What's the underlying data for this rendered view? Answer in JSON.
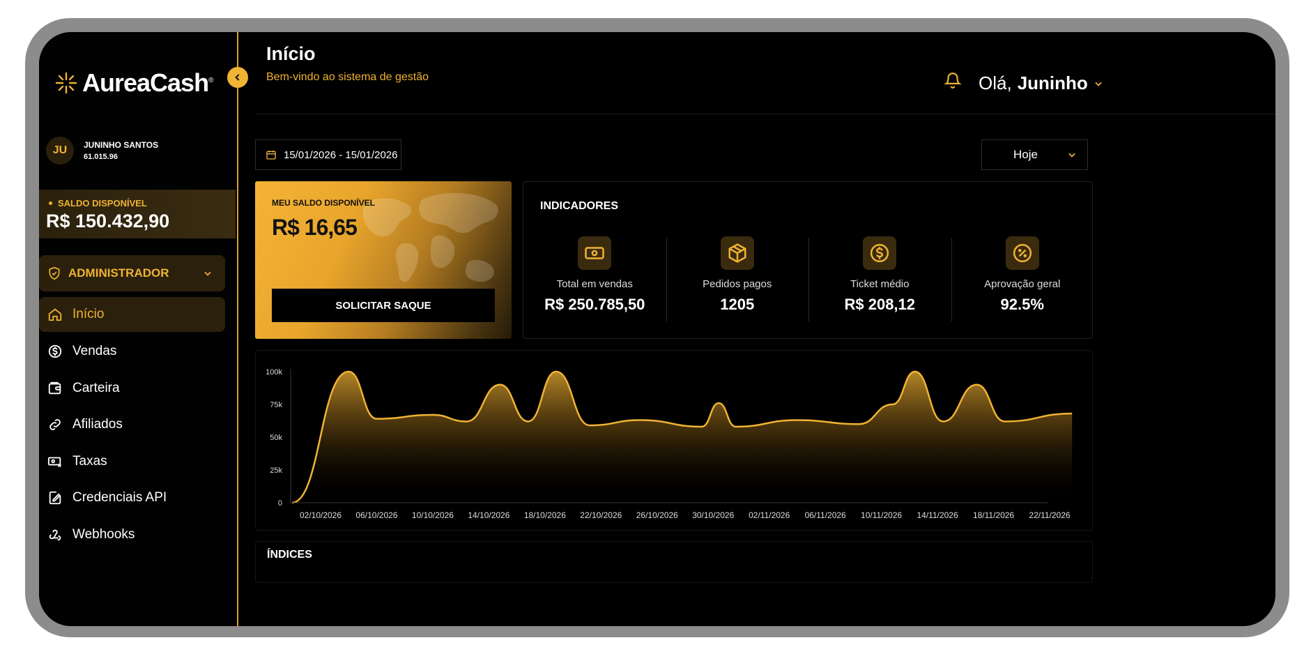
{
  "app": {
    "brand": "AureaCash",
    "brand_mark": "®"
  },
  "user": {
    "initials": "JU",
    "name": "JUNINHO SANTOS",
    "doc": "61.015.96"
  },
  "sidebar": {
    "balance_label": "SALDO DISPONÍVEL",
    "balance_value": "R$ 150.432,90",
    "role": "ADMINISTRADOR",
    "items": [
      {
        "label": "Início",
        "icon": "home-icon",
        "active": true
      },
      {
        "label": "Vendas",
        "icon": "dollar-circle-icon",
        "active": false
      },
      {
        "label": "Carteira",
        "icon": "wallet-icon",
        "active": false
      },
      {
        "label": "Afiliados",
        "icon": "link-icon",
        "active": false
      },
      {
        "label": "Taxas",
        "icon": "fee-icon",
        "active": false
      },
      {
        "label": "Credenciais API",
        "icon": "credentials-icon",
        "active": false
      },
      {
        "label": "Webhooks",
        "icon": "webhook-icon",
        "active": false
      }
    ]
  },
  "header": {
    "title": "Início",
    "subtitle": "Bem-vindo ao sistema de gestão",
    "greeting_prefix": "Olá,",
    "greeting_name": "Juninho"
  },
  "filters": {
    "date_range": "15/01/2026 - 15/01/2026",
    "period": "Hoje"
  },
  "balance_card": {
    "label": "MEU SALDO DISPONÍVEL",
    "value": "R$ 16,65",
    "button": "SOLICITAR SAQUE"
  },
  "indicators": {
    "title": "INDICADORES",
    "items": [
      {
        "label": "Total em vendas",
        "value": "R$ 250.785,50",
        "icon": "cash-icon"
      },
      {
        "label": "Pedidos pagos",
        "value": "1205",
        "icon": "package-icon"
      },
      {
        "label": "Ticket médio",
        "value": "R$ 208,12",
        "icon": "dollar-circle-icon"
      },
      {
        "label": "Aprovação geral",
        "value": "92.5%",
        "icon": "percent-badge-icon"
      }
    ]
  },
  "indices": {
    "title": "ÍNDICES"
  },
  "colors": {
    "accent": "#f0b334",
    "background": "#000000",
    "panel_active": "#2a200c"
  },
  "chart_data": {
    "type": "area",
    "ylim": [
      0,
      100000
    ],
    "y_ticks": [
      "0",
      "25k",
      "50k",
      "75k",
      "100k"
    ],
    "y_tick_values": [
      0,
      25000,
      50000,
      75000,
      100000
    ],
    "x_labels": [
      "02/10/2026",
      "06/10/2026",
      "10/10/2026",
      "14/10/2026",
      "18/10/2026",
      "22/10/2026",
      "26/10/2026",
      "30/10/2026",
      "02/11/2026",
      "06/11/2026",
      "10/11/2026",
      "14/11/2026",
      "18/11/2026",
      "22/11/2026"
    ],
    "grid": false,
    "series": [
      {
        "points": [
          [
            0,
            0
          ],
          [
            0.5,
            100000
          ],
          [
            1.0,
            64000
          ],
          [
            2.0,
            67000
          ],
          [
            2.6,
            62000
          ],
          [
            3.2,
            90000
          ],
          [
            3.7,
            62000
          ],
          [
            4.2,
            100000
          ],
          [
            4.8,
            59000
          ],
          [
            5.7,
            63000
          ],
          [
            6.8,
            58000
          ],
          [
            7.1,
            76000
          ],
          [
            7.4,
            58000
          ],
          [
            8.5,
            63000
          ],
          [
            9.6,
            60000
          ],
          [
            10.2,
            75000
          ],
          [
            10.6,
            100000
          ],
          [
            11.1,
            62000
          ],
          [
            11.7,
            90000
          ],
          [
            12.2,
            62000
          ],
          [
            13.4,
            68000
          ]
        ]
      }
    ]
  }
}
